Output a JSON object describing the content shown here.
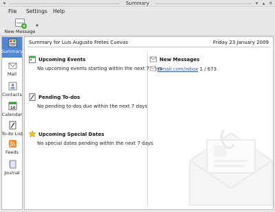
{
  "window": {
    "title": "Summary"
  },
  "menu": {
    "items": [
      "File",
      "Settings",
      "Help"
    ]
  },
  "toolbar": {
    "new_message_label": "New Message"
  },
  "sidebar": {
    "items": [
      {
        "label": "Summary",
        "icon": "summary-icon",
        "active": true
      },
      {
        "label": "Mail",
        "icon": "mail-icon",
        "active": false
      },
      {
        "label": "Contacts",
        "icon": "contacts-icon",
        "active": false
      },
      {
        "label": "Calendar",
        "icon": "calendar-icon",
        "active": false
      },
      {
        "label": "To-do List",
        "icon": "todo-icon",
        "active": false
      },
      {
        "label": "Feeds",
        "icon": "feeds-icon",
        "active": false
      },
      {
        "label": "Journal",
        "icon": "journal-icon",
        "active": false
      }
    ],
    "calendar_day": "14"
  },
  "summary": {
    "heading": "Summary for Luis Augusto Fretes Cuevas",
    "date": "Friday 23 January 2009",
    "sections": [
      {
        "title": "Upcoming Events",
        "text": "No upcoming events starting within the next 7 days"
      },
      {
        "title": "Pending To-dos",
        "text": "No pending to-dos due within the next 7 days"
      },
      {
        "title": "Upcoming Special Dates",
        "text": "No special dates pending within the next 7 days"
      }
    ],
    "messages": {
      "title": "New Messages",
      "folder_link": "Gmail.com/inbox",
      "count": "1 / 673"
    }
  },
  "colors": {
    "accent": "#4f86d6",
    "link": "#2a5db0"
  }
}
